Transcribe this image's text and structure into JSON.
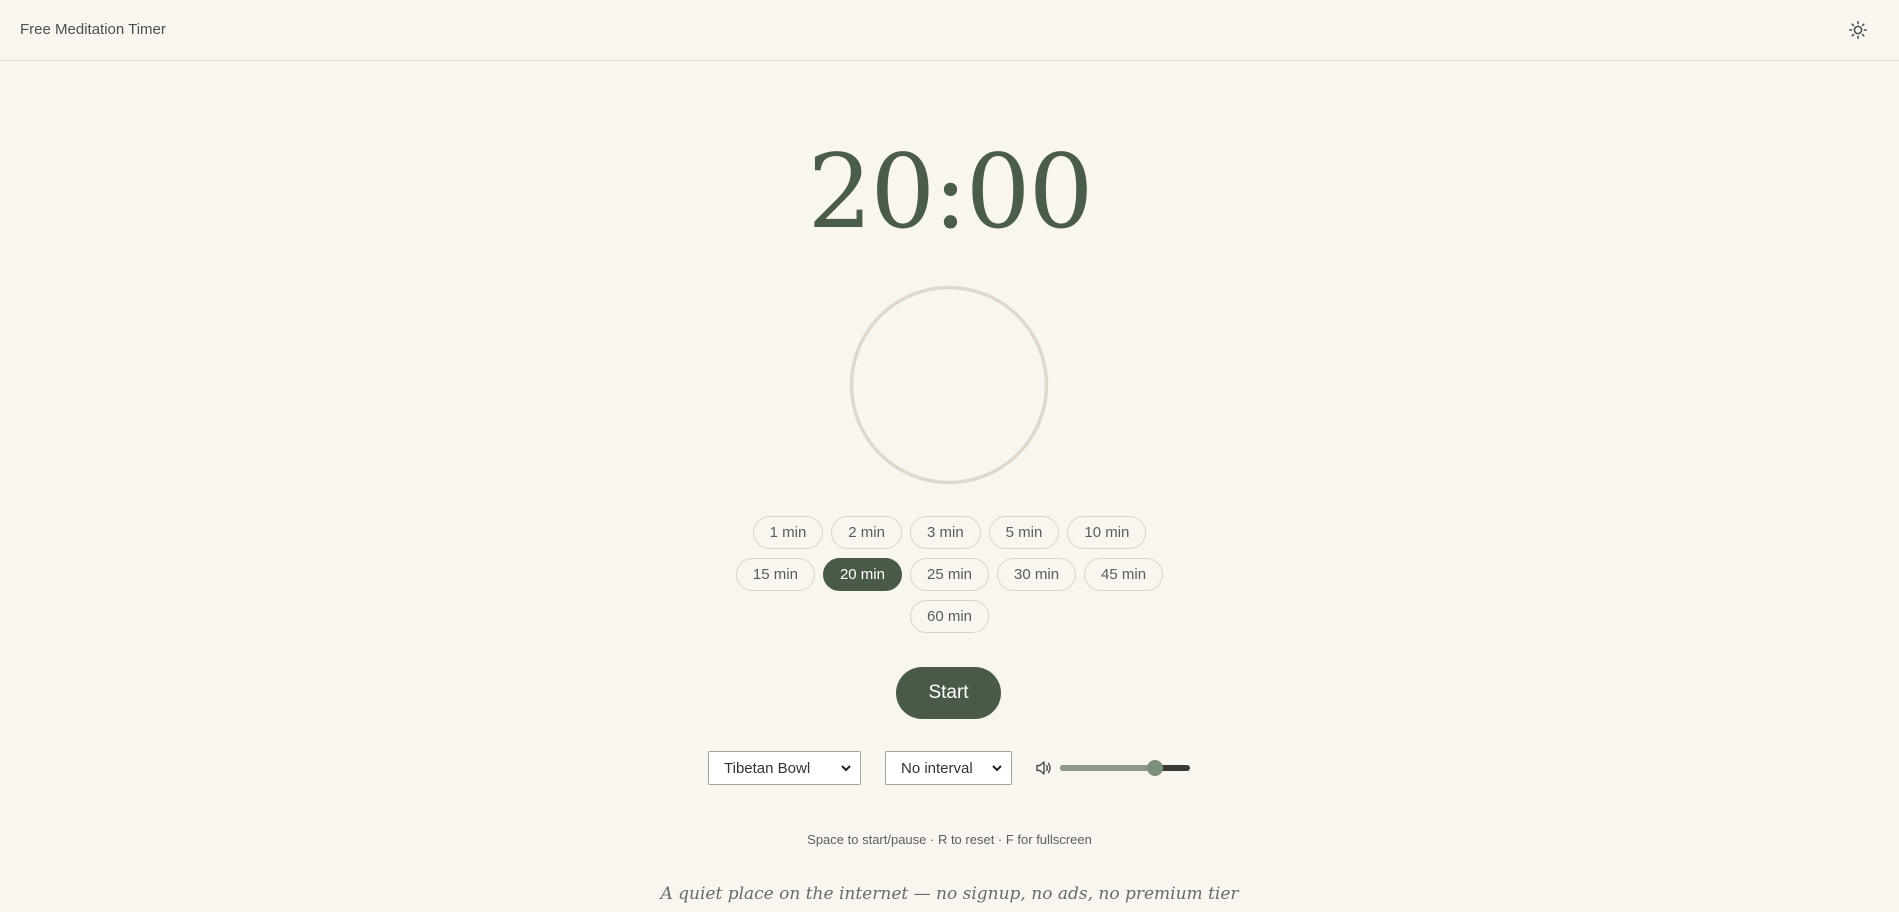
{
  "header": {
    "brand": "Free Meditation Timer",
    "theme_icon": "sun-icon"
  },
  "timer": {
    "display": "20:00",
    "progress": 0
  },
  "presets": {
    "rows": [
      [
        "1 min",
        "2 min",
        "3 min",
        "5 min",
        "10 min"
      ],
      [
        "15 min",
        "20 min",
        "25 min",
        "30 min",
        "45 min"
      ],
      [
        "60 min"
      ]
    ],
    "selected": "20 min"
  },
  "start_label": "Start",
  "sound": {
    "selected": "Tibetan Bowl"
  },
  "interval": {
    "selected": "No interval"
  },
  "volume": {
    "icon": "speaker-icon",
    "level": 0.76
  },
  "shortcuts": "Space to start/pause · R to reset · F for fullscreen",
  "tagline": "A quiet place on the internet — no signup, no ads, no premium tier",
  "colors": {
    "background": "#f9f6f0",
    "accent": "#4a5a48",
    "ring": "#e0d9cb",
    "timer_text": "#4a5c4a"
  }
}
